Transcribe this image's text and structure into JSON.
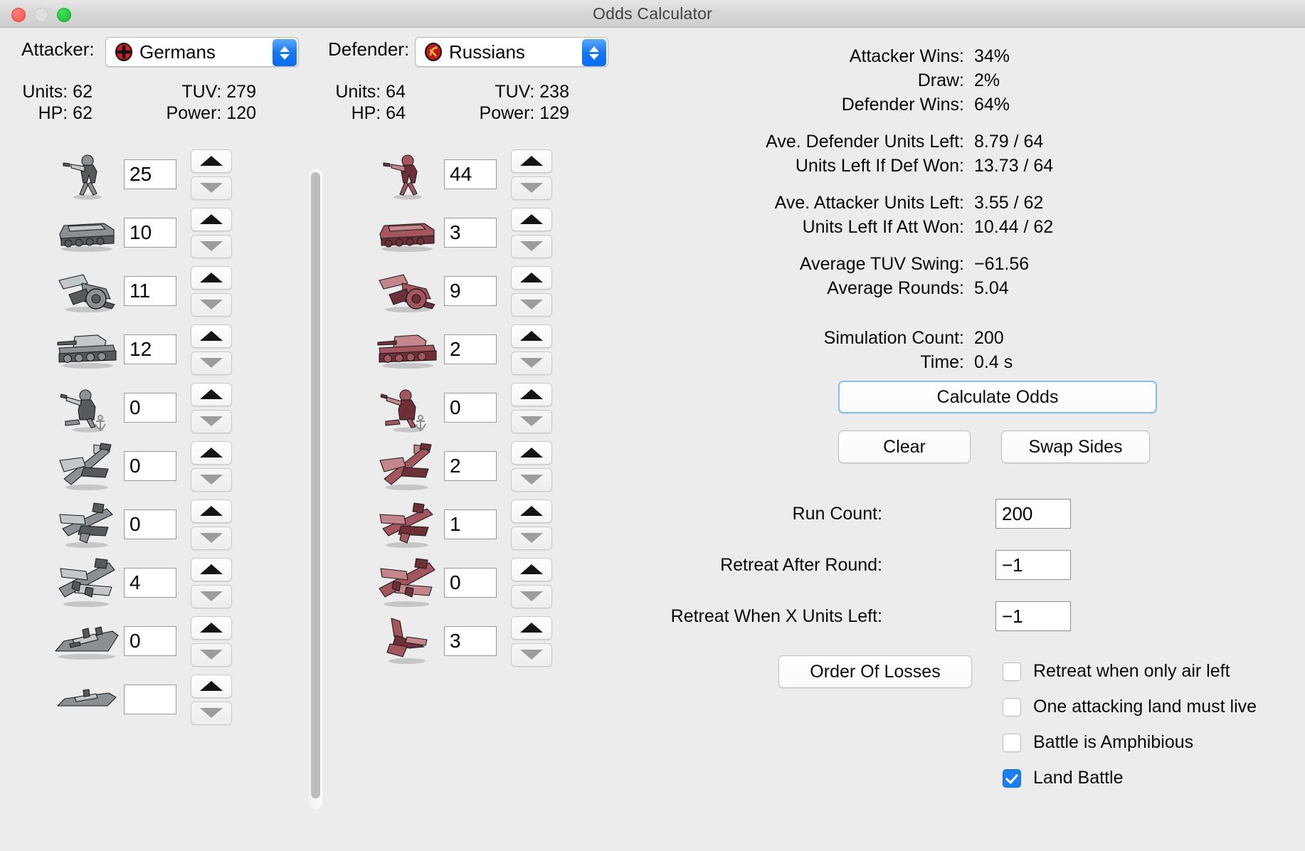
{
  "window": {
    "title": "Odds Calculator",
    "traffic_lights": [
      "close-button",
      "minimize-button",
      "zoom-button"
    ]
  },
  "attacker": {
    "label": "Attacker:",
    "selected": "Germans",
    "flag_icon": "german-iron-cross-icon",
    "stats": [
      {
        "k": "Units: 62",
        "v": "TUV: 279"
      },
      {
        "k": "HP: 62",
        "v": "Power: 120"
      }
    ]
  },
  "defender": {
    "label": "Defender:",
    "selected": "Russians",
    "flag_icon": "soviet-hammer-sickle-icon",
    "stats": [
      {
        "k": "Units: 64",
        "v": "TUV: 238"
      },
      {
        "k": "HP: 64",
        "v": "Power: 129"
      }
    ]
  },
  "attacker_units": [
    {
      "icon": "infantry-icon",
      "value": "25"
    },
    {
      "icon": "mech-infantry-icon",
      "value": "10"
    },
    {
      "icon": "artillery-icon",
      "value": "11"
    },
    {
      "icon": "tank-icon",
      "value": "12"
    },
    {
      "icon": "marine-infantry-icon",
      "value": "0"
    },
    {
      "icon": "fighter-icon",
      "value": "0"
    },
    {
      "icon": "tactical-bomber-icon",
      "value": "0"
    },
    {
      "icon": "strategic-bomber-icon",
      "value": "4"
    },
    {
      "icon": "battleship-icon",
      "value": "0"
    },
    {
      "icon": "cruiser-icon",
      "value": ""
    }
  ],
  "defender_units": [
    {
      "icon": "infantry-icon",
      "value": "44"
    },
    {
      "icon": "mech-infantry-icon",
      "value": "3"
    },
    {
      "icon": "artillery-icon",
      "value": "9"
    },
    {
      "icon": "tank-icon",
      "value": "2"
    },
    {
      "icon": "marine-infantry-icon",
      "value": "0"
    },
    {
      "icon": "fighter-icon",
      "value": "2"
    },
    {
      "icon": "tactical-bomber-icon",
      "value": "1"
    },
    {
      "icon": "strategic-bomber-icon",
      "value": "0"
    },
    {
      "icon": "jet-fighter-icon",
      "value": "3"
    }
  ],
  "results": [
    {
      "key": "Attacker Wins:",
      "value": "34%"
    },
    {
      "key": "Draw:",
      "value": "2%"
    },
    {
      "key": "Defender Wins:",
      "value": "64%"
    }
  ],
  "results2": [
    {
      "key": "Ave. Defender Units Left:",
      "value": "8.79 / 64"
    },
    {
      "key": "Units Left If Def Won:",
      "value": "13.73 / 64"
    }
  ],
  "results3": [
    {
      "key": "Ave. Attacker Units Left:",
      "value": "3.55 / 62"
    },
    {
      "key": "Units Left If Att Won:",
      "value": "10.44 / 62"
    }
  ],
  "results4": [
    {
      "key": "Average TUV Swing:",
      "value": "−61.56"
    },
    {
      "key": "Average Rounds:",
      "value": "5.04"
    }
  ],
  "results5": [
    {
      "key": "Simulation Count:",
      "value": "200"
    },
    {
      "key": "Time:",
      "value": "0.4 s"
    }
  ],
  "buttons": {
    "calculate": "Calculate Odds",
    "clear": "Clear",
    "swap": "Swap Sides",
    "order_of_losses": "Order Of Losses"
  },
  "fields": [
    {
      "label": "Run Count:",
      "value": "200"
    },
    {
      "label": "Retreat After Round:",
      "value": "−1"
    },
    {
      "label": "Retreat When X Units Left:",
      "value": "−1"
    }
  ],
  "checkboxes": [
    {
      "label": "Retreat when only air left",
      "checked": false
    },
    {
      "label": "One attacking land must live",
      "checked": false
    },
    {
      "label": "Battle is Amphibious",
      "checked": false
    },
    {
      "label": "Land Battle",
      "checked": true
    }
  ],
  "colors": {
    "window_bg": "#ececec",
    "accent_blue": "#1a7ef4",
    "attacker_unit": "#808080",
    "defender_unit": "#a04a52",
    "focus_ring": "#83bdf2"
  },
  "scrollbar": {
    "name": "attacker-list-scrollbar"
  }
}
